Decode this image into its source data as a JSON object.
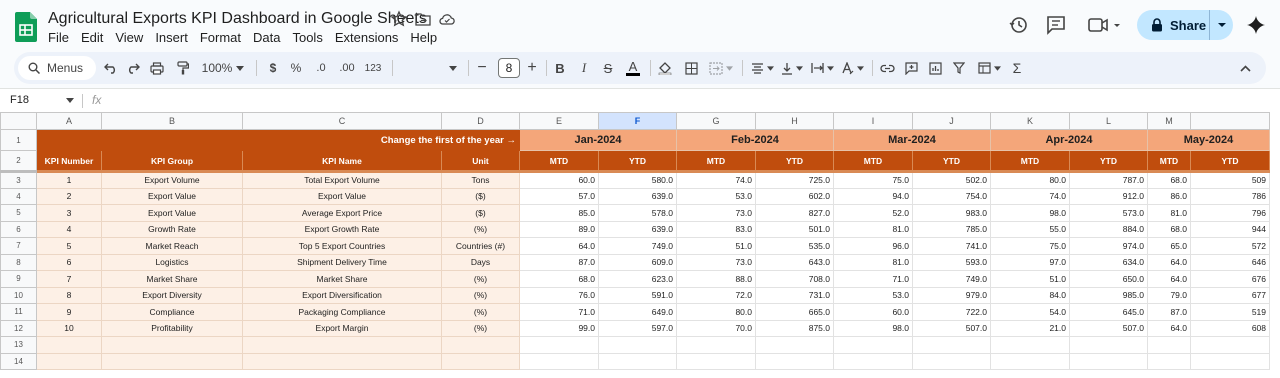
{
  "app": {
    "title": "Agricultural Exports KPI Dashboard in Google Sheets",
    "menu": [
      "File",
      "Edit",
      "View",
      "Insert",
      "Format",
      "Data",
      "Tools",
      "Extensions",
      "Help"
    ],
    "share_label": "Share",
    "brand_color": "#0f9d58"
  },
  "toolbar": {
    "menus_label": "Menus",
    "zoom": "100%",
    "currency": "$",
    "percent": "%",
    "decrease_decimal": ".0",
    "increase_decimal": ".00",
    "number_format": "123",
    "font_size": "8"
  },
  "formula_bar": {
    "cell_ref": "F18",
    "fx": "fx"
  },
  "sheet": {
    "columns": [
      "A",
      "B",
      "C",
      "D",
      "E",
      "F",
      "G",
      "H",
      "I",
      "J",
      "K",
      "L",
      "M"
    ],
    "selected_column": "F",
    "row_numbers": [
      "1",
      "2",
      "3",
      "4",
      "5",
      "6",
      "7",
      "8",
      "9",
      "10",
      "11",
      "12",
      "13",
      "14"
    ],
    "banner_text": "Change the first of the year →",
    "months": [
      "Jan-2024",
      "Feb-2024",
      "Mar-2024",
      "Apr-2024",
      "May-2024"
    ],
    "headers": {
      "kpi_number": "KPI Number",
      "kpi_group": "KPI Group",
      "kpi_name": "KPI Name",
      "unit": "Unit",
      "mtd": "MTD",
      "ytd": "YTD"
    },
    "colors": {
      "header_dark": "#c04d0d",
      "month_band": "#f4a67a",
      "row_fill": "#fdf0e6"
    },
    "rows": [
      {
        "num": "1",
        "group": "Export Volume",
        "name": "Total Export Volume",
        "unit": "Tons",
        "vals": [
          "60.0",
          "580.0",
          "74.0",
          "725.0",
          "75.0",
          "502.0",
          "80.0",
          "787.0",
          "68.0",
          "509"
        ]
      },
      {
        "num": "2",
        "group": "Export Value",
        "name": "Export Value",
        "unit": "($)",
        "vals": [
          "57.0",
          "639.0",
          "53.0",
          "602.0",
          "94.0",
          "754.0",
          "74.0",
          "912.0",
          "86.0",
          "786"
        ]
      },
      {
        "num": "3",
        "group": "Export Value",
        "name": "Average Export Price",
        "unit": "($)",
        "vals": [
          "85.0",
          "578.0",
          "73.0",
          "827.0",
          "52.0",
          "983.0",
          "98.0",
          "573.0",
          "81.0",
          "796"
        ]
      },
      {
        "num": "4",
        "group": "Growth Rate",
        "name": "Export Growth Rate",
        "unit": "(%)",
        "vals": [
          "89.0",
          "639.0",
          "83.0",
          "501.0",
          "81.0",
          "785.0",
          "55.0",
          "884.0",
          "68.0",
          "944"
        ]
      },
      {
        "num": "5",
        "group": "Market Reach",
        "name": "Top 5 Export Countries",
        "unit": "Countries (#)",
        "vals": [
          "64.0",
          "749.0",
          "51.0",
          "535.0",
          "96.0",
          "741.0",
          "75.0",
          "974.0",
          "65.0",
          "572"
        ]
      },
      {
        "num": "6",
        "group": "Logistics",
        "name": "Shipment Delivery Time",
        "unit": "Days",
        "vals": [
          "87.0",
          "609.0",
          "73.0",
          "643.0",
          "81.0",
          "593.0",
          "97.0",
          "634.0",
          "64.0",
          "646"
        ]
      },
      {
        "num": "7",
        "group": "Market Share",
        "name": "Market Share",
        "unit": "(%)",
        "vals": [
          "68.0",
          "623.0",
          "88.0",
          "708.0",
          "71.0",
          "749.0",
          "51.0",
          "650.0",
          "64.0",
          "676"
        ]
      },
      {
        "num": "8",
        "group": "Export Diversity",
        "name": "Export Diversification",
        "unit": "(%)",
        "vals": [
          "76.0",
          "591.0",
          "72.0",
          "731.0",
          "53.0",
          "979.0",
          "84.0",
          "985.0",
          "79.0",
          "677"
        ]
      },
      {
        "num": "9",
        "group": "Compliance",
        "name": "Packaging Compliance",
        "unit": "(%)",
        "vals": [
          "71.0",
          "649.0",
          "80.0",
          "665.0",
          "60.0",
          "722.0",
          "54.0",
          "645.0",
          "87.0",
          "519"
        ]
      },
      {
        "num": "10",
        "group": "Profitability",
        "name": "Export Margin",
        "unit": "(%)",
        "vals": [
          "99.0",
          "597.0",
          "70.0",
          "875.0",
          "98.0",
          "507.0",
          "21.0",
          "507.0",
          "64.0",
          "608"
        ]
      }
    ]
  }
}
